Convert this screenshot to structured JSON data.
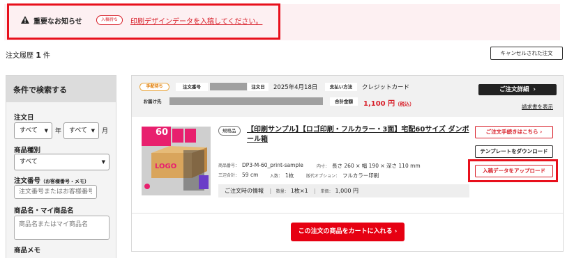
{
  "notice": {
    "title": "重要なお知らせ",
    "badge": "入稿待ち",
    "link": "印刷デザインデータを入稿してください。"
  },
  "history": {
    "label": "注文履歴",
    "count": "1",
    "unit": "件"
  },
  "cancelled_button": "キャンセルされた注文",
  "sidebar": {
    "heading": "条件で検索する",
    "order_date_label": "注文日",
    "year_select": "すべて",
    "year_unit": "年",
    "month_select": "すべて",
    "month_unit": "月",
    "product_type_label": "商品種別",
    "product_type_select": "すべて",
    "order_no_label": "注文番号",
    "order_no_note": "（お客様番号・メモ）",
    "order_no_placeholder": "注文番号またはお客様番号",
    "product_name_label": "商品名・マイ商品名",
    "product_name_placeholder": "商品名またはマイ商品名",
    "memo_label": "商品メモ"
  },
  "order": {
    "status": "手配待ち",
    "order_no_label": "注文番号",
    "order_date_label": "注文日",
    "order_date": "2025年4月18日",
    "payment_label": "支払い方法",
    "payment": "クレジットカード",
    "ship_to_label": "お届け先",
    "total_label": "合計金額",
    "total": "1,100 円",
    "tax_note": "（税込）",
    "detail_button": "ご注文詳細",
    "invoice_link": "請求書を表示",
    "category": "規格品",
    "product_name": "【印刷サンプル】【ロゴ印刷・フルカラー・3面】宅配60サイズ ダンボール箱",
    "product_code_label": "商品番号：",
    "product_code": "DP3-M-60_print-sample",
    "size_label": "内寸：",
    "size": "長さ 260 × 幅 190 × 深さ 110 mm",
    "sum3_label": "三辺合計：",
    "sum3": "59 cm",
    "per_label": "入数：",
    "per": "1枚",
    "option_label": "版代オプション：",
    "option": "フルカラー印刷",
    "info_title": "ご注文時の情報",
    "qty_label": "数量：",
    "qty": "1枚×1",
    "unit_price_label": "単価：",
    "unit_price": "1,000 円",
    "action_procedure": "ご注文手続きはこちら",
    "action_template": "テンプレートをダウンロード",
    "action_upload": "入稿データをアップロード",
    "cart_button": "この注文の商品をカートに入れる",
    "image_texts": {
      "size": "60",
      "logo": "LOGO"
    }
  },
  "colors": {
    "accent": "#e60012",
    "status": "#e07a00",
    "highlight": "#e8101c"
  }
}
